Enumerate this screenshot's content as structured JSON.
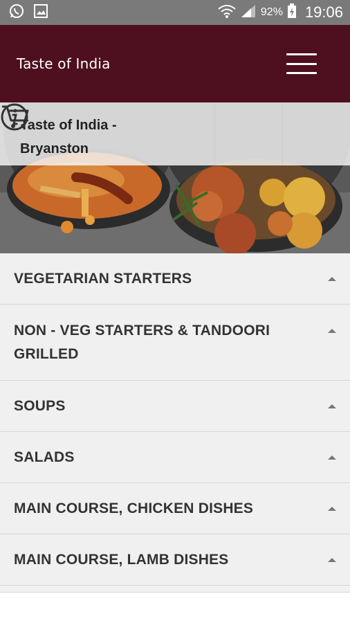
{
  "status_bar": {
    "battery": "92%",
    "time": "19:06",
    "icons": [
      "whatsapp-icon",
      "gallery-icon",
      "wifi-icon",
      "signal-icon",
      "battery-charging-icon"
    ]
  },
  "app_bar": {
    "title": "Taste of India"
  },
  "hero": {
    "restaurant_line1": "Taste of India -",
    "restaurant_line2": "Bryanston",
    "info_icon": "info-icon",
    "cart_icon": "cart-icon"
  },
  "categories": [
    {
      "label": "VEGETARIAN STARTERS"
    },
    {
      "label": "NON - VEG STARTERS & TANDOORI GRILLED"
    },
    {
      "label": "SOUPS"
    },
    {
      "label": "SALADS"
    },
    {
      "label": "MAIN COURSE, CHICKEN DISHES"
    },
    {
      "label": "MAIN COURSE, LAMB DISHES"
    }
  ],
  "colors": {
    "app_bar": "#4e0f1f",
    "status_bar": "#7a7a7a",
    "list_bg": "#f0f0f0"
  }
}
